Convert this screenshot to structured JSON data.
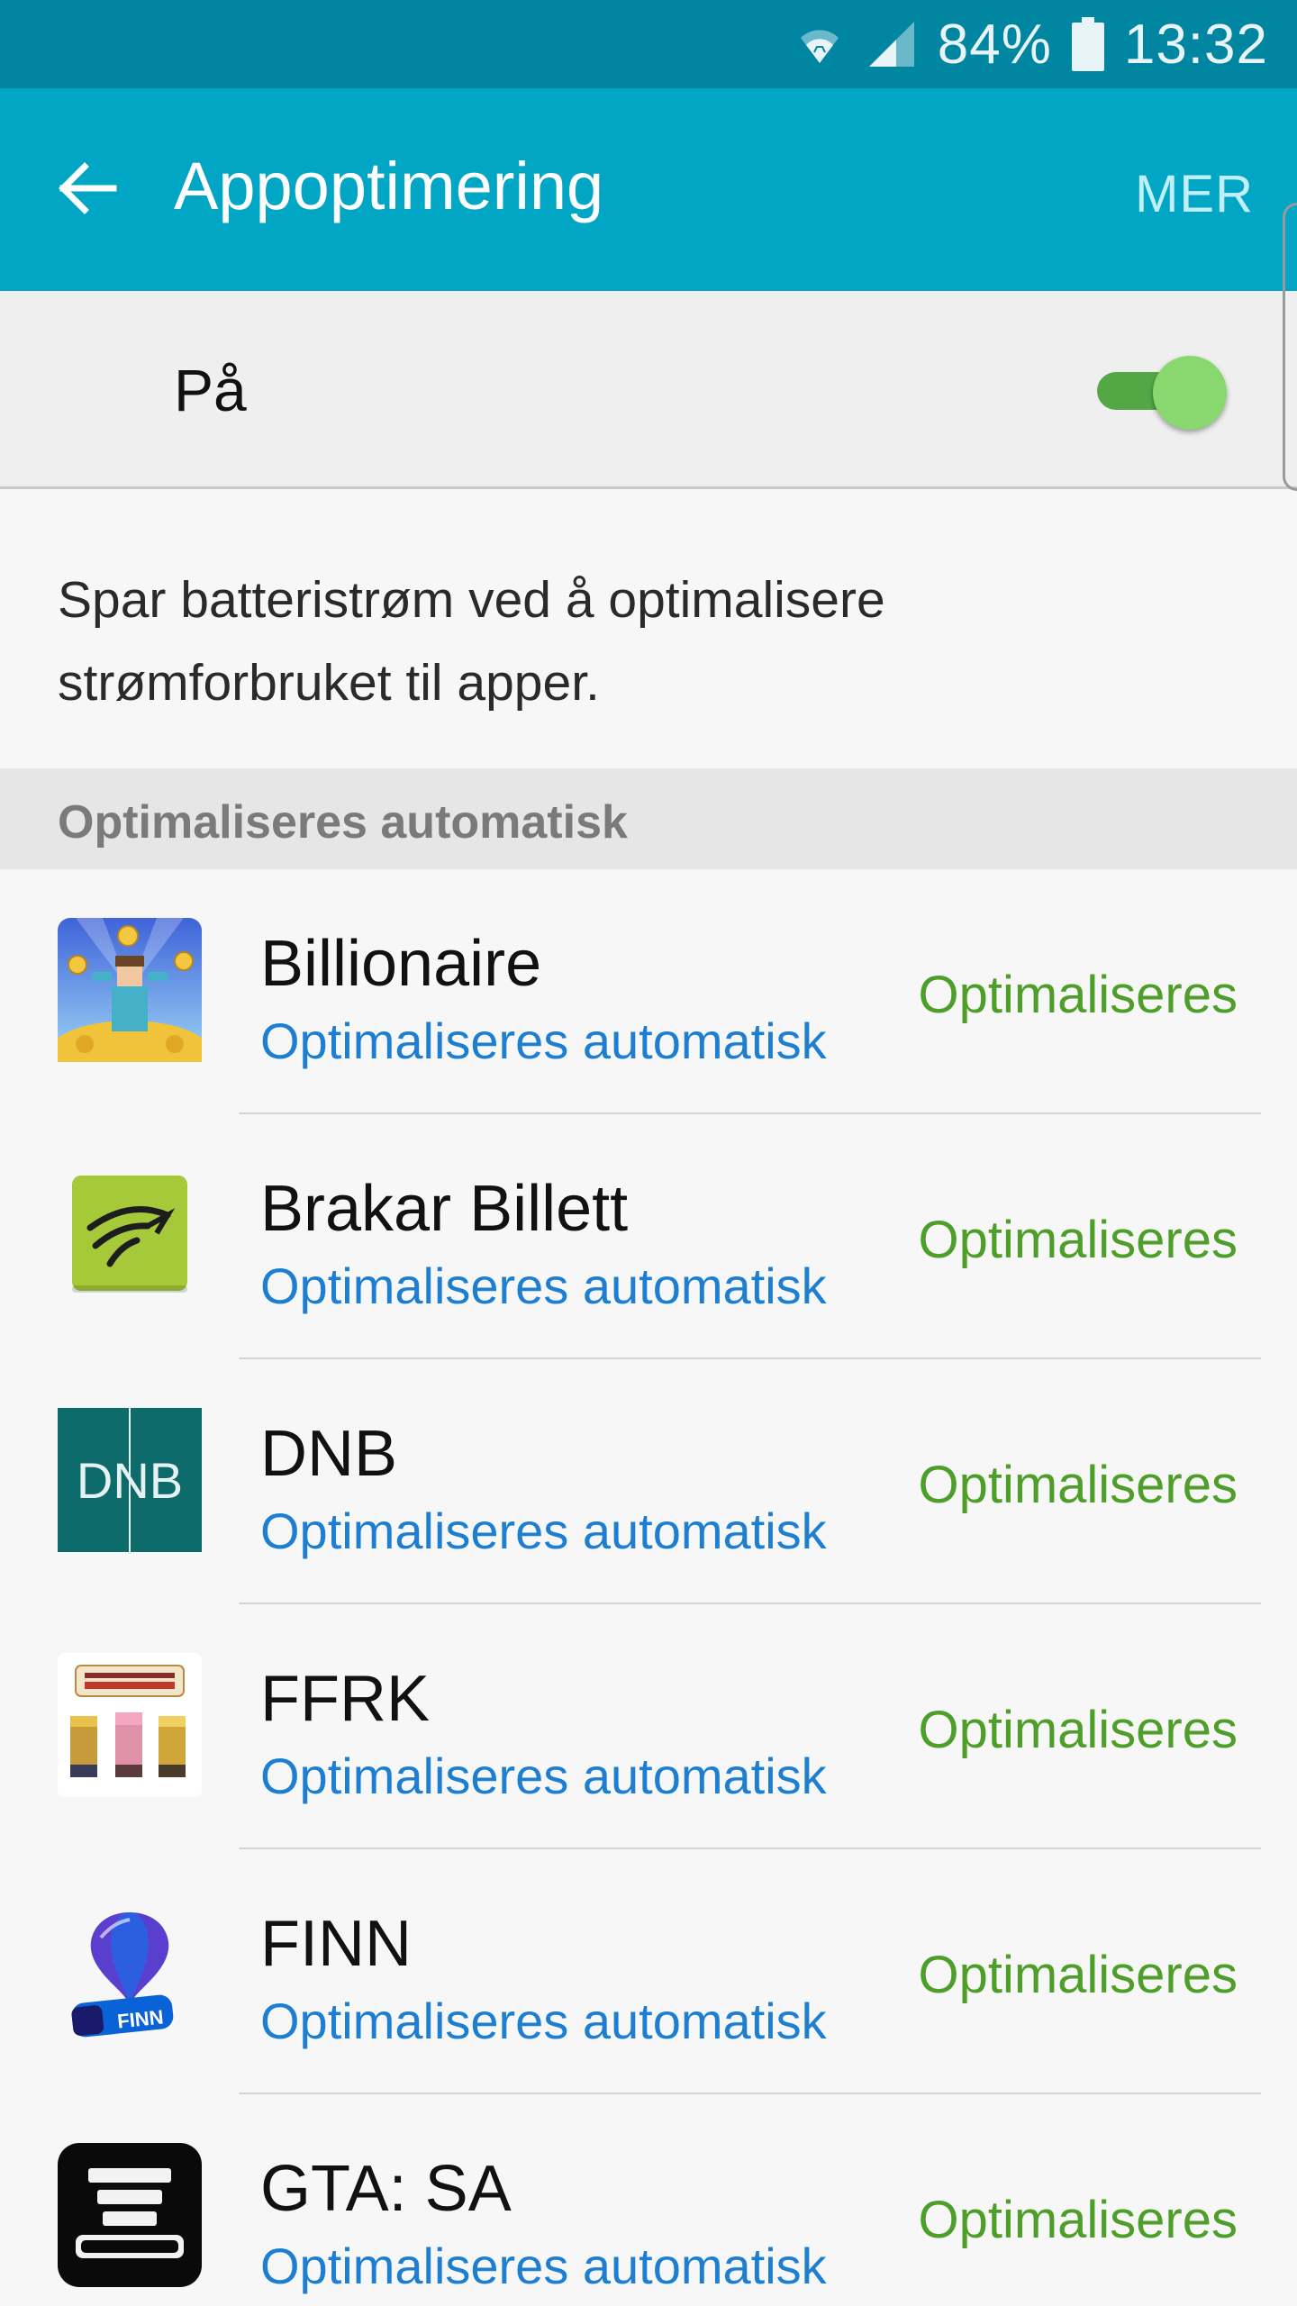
{
  "status_bar": {
    "battery_percent": "84%",
    "time": "13:32",
    "icons": [
      "wifi-icon",
      "signal-icon",
      "battery-icon"
    ]
  },
  "app_bar": {
    "title": "Appoptimering",
    "more_label": "MER",
    "back_icon": "back-arrow-icon",
    "color": "#01a6c5"
  },
  "master_switch": {
    "label": "På",
    "state": "on",
    "color": "#53a845"
  },
  "description": "Spar batteristrøm ved å optimalisere strømforbruket til apper.",
  "section": {
    "title": "Optimaliseres automatisk"
  },
  "apps": [
    {
      "name": "Billionaire",
      "subtitle": "Optimaliseres automatisk",
      "status": "Optimaliseres",
      "icon": "billionaire-icon"
    },
    {
      "name": "Brakar Billett",
      "subtitle": "Optimaliseres automatisk",
      "status": "Optimaliseres",
      "icon": "brakar-icon"
    },
    {
      "name": "DNB",
      "subtitle": "Optimaliseres automatisk",
      "status": "Optimaliseres",
      "icon": "dnb-icon",
      "icon_text": "DNB"
    },
    {
      "name": "FFRK",
      "subtitle": "Optimaliseres automatisk",
      "status": "Optimaliseres",
      "icon": "ffrk-icon"
    },
    {
      "name": "FINN",
      "subtitle": "Optimaliseres automatisk",
      "status": "Optimaliseres",
      "icon": "finn-icon",
      "icon_text": "FINN"
    },
    {
      "name": "GTA: SA",
      "subtitle": "Optimaliseres automatisk",
      "status": "Optimaliseres",
      "icon": "gta-icon"
    }
  ],
  "colors": {
    "subtitle": "#1e7fd2",
    "status": "#4e9e2a",
    "status_bar": "#0186a2"
  }
}
